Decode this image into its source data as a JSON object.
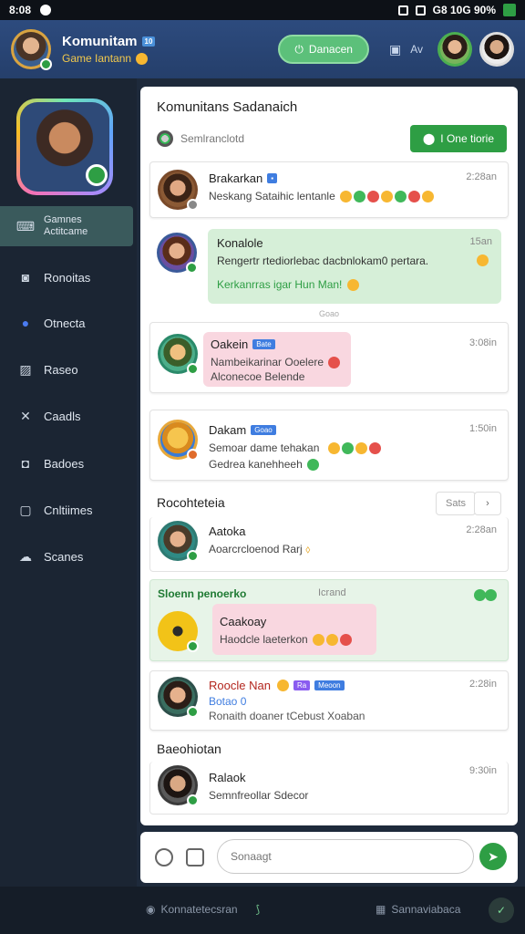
{
  "statusbar": {
    "time": "8:08",
    "right_text": "G8 10G 90%"
  },
  "header": {
    "title": "Komunitam",
    "title_badge": "10",
    "subtitle": "Game Iantann",
    "join_label": "Danacen",
    "right_label": "Av"
  },
  "sidebar": {
    "items": [
      {
        "label": "Gamnes",
        "label2": "Actitcame",
        "icon": "gamepad-icon"
      },
      {
        "label": "Ronoitas",
        "icon": "camera-icon"
      },
      {
        "label": "Otnecta",
        "icon": "globe-icon"
      },
      {
        "label": "Raseo",
        "icon": "image-icon"
      },
      {
        "label": "Caadls",
        "icon": "tools-icon"
      },
      {
        "label": "Badoes",
        "icon": "photo-icon"
      },
      {
        "label": "Cnltiimes",
        "icon": "frame-icon"
      },
      {
        "label": "Scanes",
        "icon": "cloud-icon"
      }
    ]
  },
  "main": {
    "title": "Komunitans Sadanaich",
    "subtitle": "Semlranclotd",
    "one_button": "I One tiorie",
    "messages": [
      {
        "name": "Brakarkan",
        "text": "Neskang Sataihic lentanle",
        "time": "2:28an"
      },
      {
        "name": "Konalole",
        "text": "Rengertr rtediorlebac dacbnlokam0 pertara.",
        "text2": "Kerkanrras igar Hun Man!",
        "time": "15an"
      },
      {
        "name": "Oakein",
        "tag": "Bate",
        "text": "Nambeikarinar Ooelere",
        "text2": "Alconecoe Belende",
        "time": "3:08in"
      },
      {
        "name": "Dakam",
        "tag": "Goao",
        "text": "Semoar dame tehakan",
        "text2": "Gedrea kanehheeh",
        "time": "1:50in"
      },
      {
        "name": "Aatoka",
        "text": "Aoarcrcloenod Rarj",
        "time": "2:28an"
      },
      {
        "name": "Caakoay",
        "text": "Haodcle laeterkon",
        "time": ""
      },
      {
        "name": "Roocle Nan",
        "tag": "Ra",
        "tag2": "Meoon",
        "text": "Botao 0",
        "text2": "Ronaith doaner tCebust Xoaban",
        "time": "2:28in"
      },
      {
        "name": "Ralaok",
        "text": "Semnfreollar Sdecor",
        "time": "9:30in"
      }
    ],
    "divider": "Goao",
    "section1": "Rocohteteia",
    "section1_pill": "Sats",
    "green_header": "Sloenn penoerko",
    "green_header_mid": "Icrand",
    "section2": "Baeohiotan"
  },
  "input": {
    "placeholder": "Sonaagt"
  },
  "bottombar": {
    "left": "Konnatetecsran",
    "right": "Sannaviabaca"
  }
}
